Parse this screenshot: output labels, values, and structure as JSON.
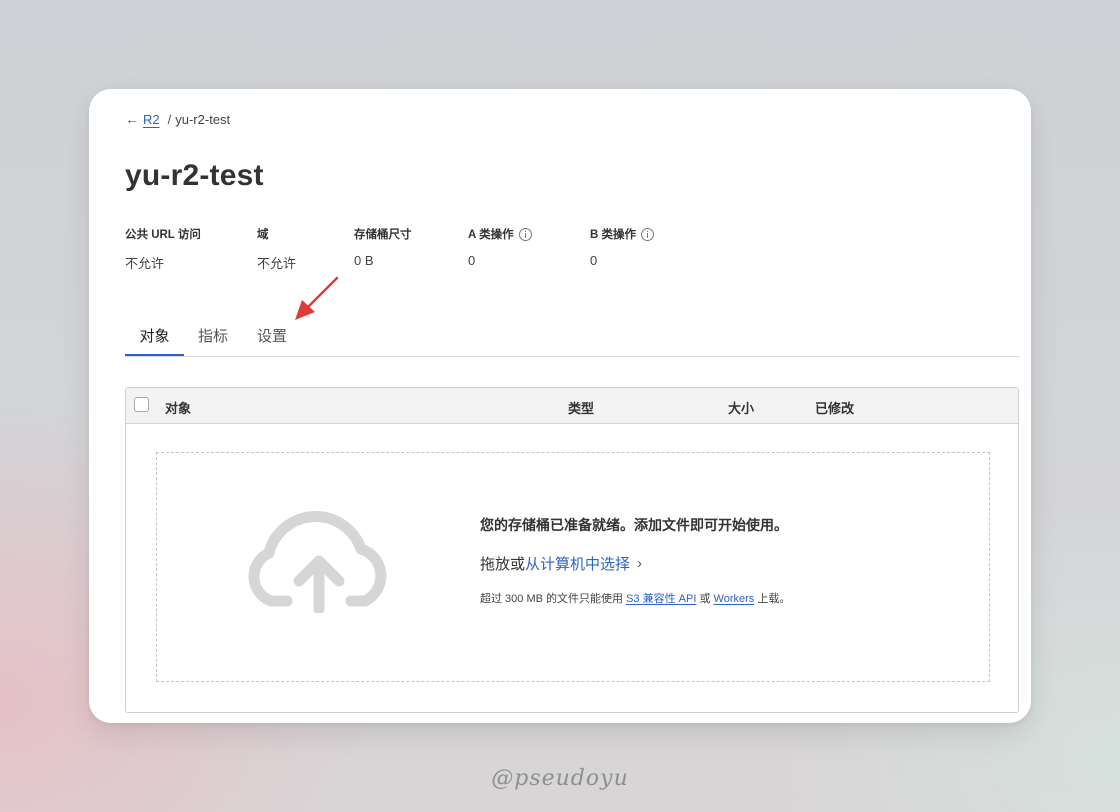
{
  "breadcrumb": {
    "back_label": "R2",
    "separator": "/",
    "current": "yu-r2-test"
  },
  "page": {
    "title": "yu-r2-test"
  },
  "stats": [
    {
      "label": "公共 URL 访问",
      "value": "不允许"
    },
    {
      "label": "域",
      "value": "不允许"
    },
    {
      "label": "存储桶尺寸",
      "value": "0 B"
    },
    {
      "label": "A 类操作",
      "value": "0",
      "icon": "info-icon"
    },
    {
      "label": "B 类操作",
      "value": "0",
      "icon": "info-icon"
    }
  ],
  "tabs": [
    {
      "label": "对象",
      "active": true
    },
    {
      "label": "指标",
      "active": false
    },
    {
      "label": "设置",
      "active": false
    }
  ],
  "table": {
    "columns": [
      "对象",
      "类型",
      "大小",
      "已修改"
    ]
  },
  "dropzone": {
    "icon": "cloud-upload-icon",
    "heading": "您的存储桶已准备就绪。添加文件即可开始使用。",
    "action_prefix": "拖放或",
    "action_link": "从计算机中选择",
    "note_prefix": "超过 300 MB 的文件只能使用",
    "note_link1": "S3 兼容性 API",
    "note_mid": "或",
    "note_link2": "Workers",
    "note_suffix": "上载。"
  },
  "watermark": "@pseudoyu",
  "colors": {
    "accent": "#2b63c6",
    "annotation": "#e03b3b"
  }
}
